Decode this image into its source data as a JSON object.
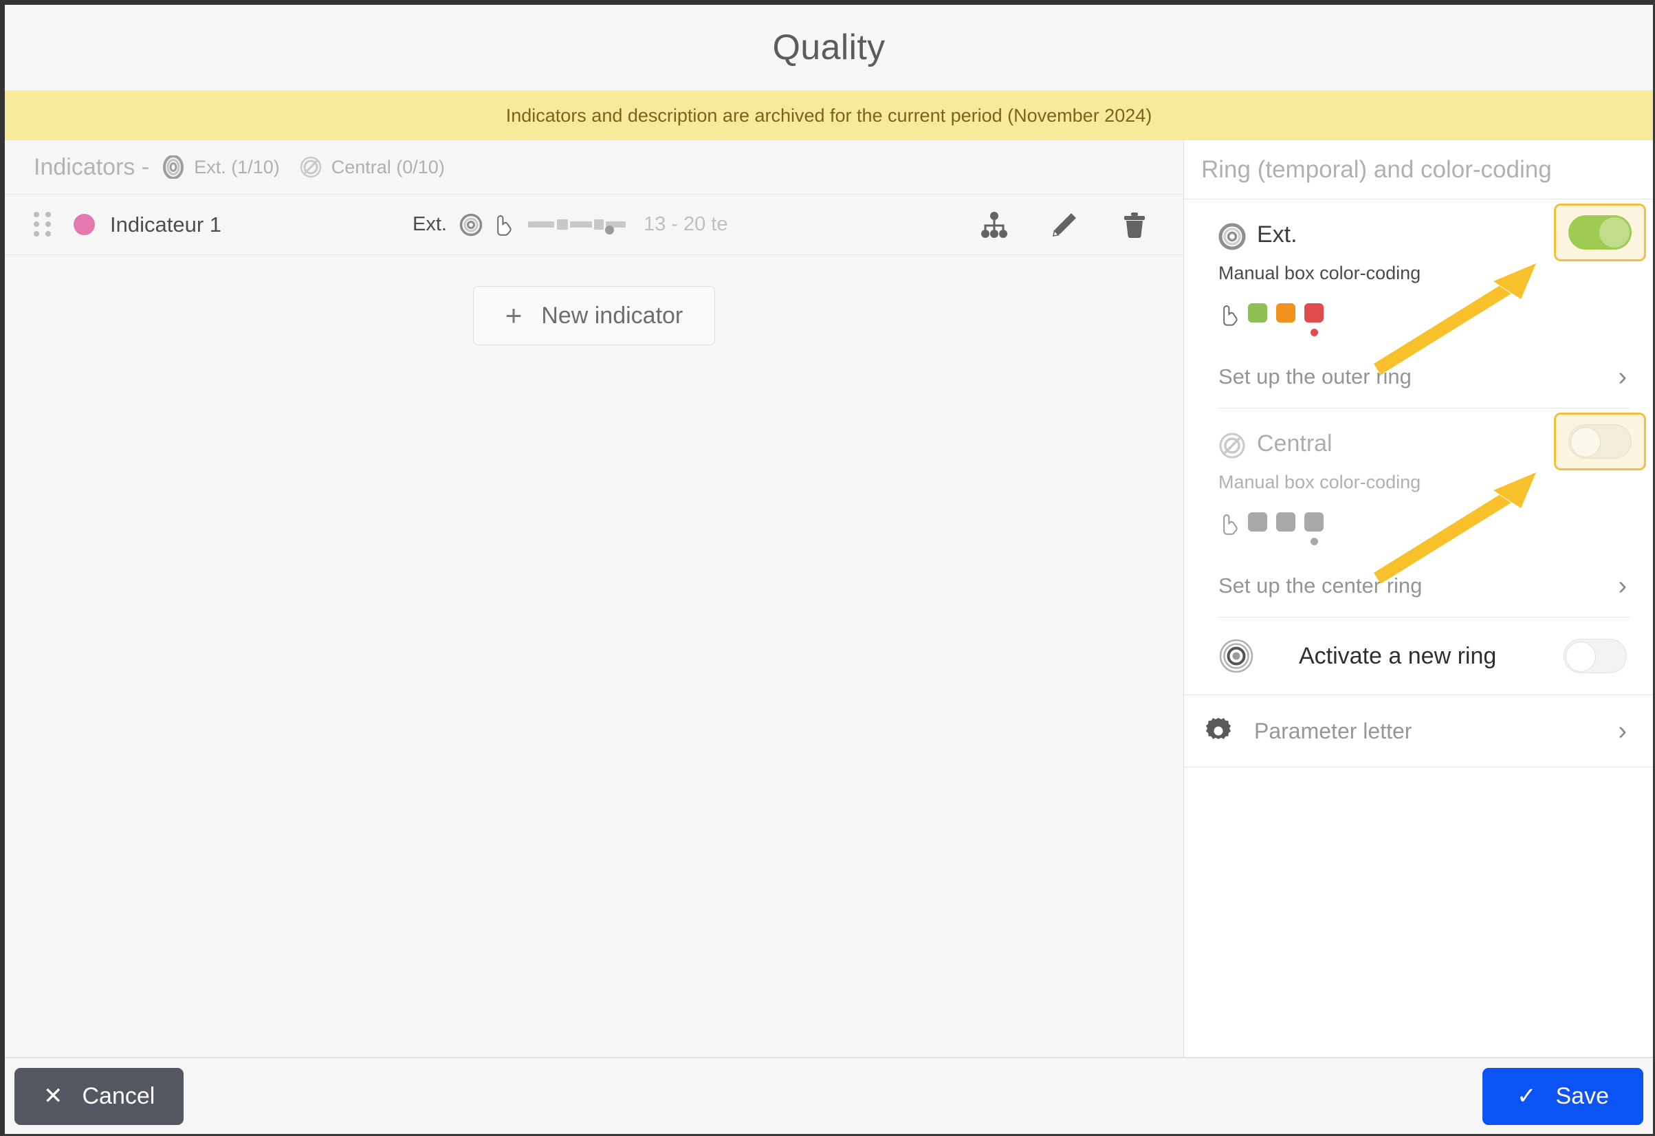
{
  "window": {
    "title": "Quality",
    "banner": "Indicators and description are archived for the current period (November 2024)"
  },
  "left_panel": {
    "header": {
      "label": "Indicators -",
      "tabs": [
        {
          "icon": "target-icon",
          "text": "Ext. (1/10)"
        },
        {
          "icon": "central-ring-icon",
          "text": "Central (0/10)"
        }
      ]
    },
    "indicators": [
      {
        "drag_handle": "drag-handle-icon",
        "color": "#e377ae",
        "name": "Indicateur 1",
        "ring_label": "Ext.",
        "ring_icon": "target-icon",
        "hand_icon": "hand-pointer-icon",
        "range": "13 - 20 te",
        "actions": [
          "hierarchy-icon",
          "edit-pencil-icon",
          "delete-trash-icon"
        ]
      }
    ],
    "new_indicator": {
      "plus": "+",
      "label": "New indicator"
    }
  },
  "sidebar": {
    "title": "Ring (temporal) and color-coding",
    "sections": [
      {
        "icon": "target-icon",
        "label": "Ext.",
        "subtitle": "Manual box color-coding",
        "toggle_state": "on",
        "swatches": [
          "#8dbf52",
          "#f0921e",
          "#e04b4b"
        ],
        "mini_dot": "#e04b4b",
        "link": "Set up the outer ring"
      },
      {
        "icon": "central-ring-icon",
        "label": "Central",
        "subtitle": "Manual box color-coding",
        "toggle_state": "off",
        "swatches": [
          "#a8a8a8",
          "#a8a8a8",
          "#a8a8a8"
        ],
        "mini_dot": "#a8a8a8",
        "link": "Set up the center ring"
      }
    ],
    "activate": {
      "icon": "new-ring-icon",
      "label": "Activate a new ring",
      "toggle_state": "off"
    },
    "parameter": {
      "icon": "gear-icon",
      "label": "Parameter letter"
    }
  },
  "footer": {
    "cancel": {
      "icon": "close-x-icon",
      "label": "Cancel"
    },
    "save": {
      "icon": "check-icon",
      "label": "Save"
    }
  },
  "colors": {
    "accent_save": "#0b53f2",
    "banner_bg": "#f7eb9b",
    "toggle_on": "#9ecb52",
    "highlight_border": "#f2bf3f",
    "highlight_bg": "#fdf5df",
    "arrow": "#f8c12c"
  }
}
